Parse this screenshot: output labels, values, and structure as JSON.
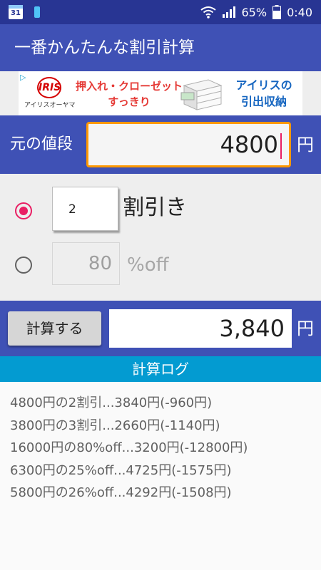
{
  "status_bar": {
    "calendar_day": "31",
    "battery_percent": "65%",
    "time": "0:40",
    "icons": [
      "calendar-icon",
      "battery-small-icon",
      "wifi-icon",
      "signal-icon",
      "battery-icon"
    ]
  },
  "app_bar": {
    "title": "一番かんたんな割引計算"
  },
  "ad": {
    "logo_mark": "IRIS",
    "logo_text": "アイリスオーヤマ",
    "line1": "押入れ・クローゼット",
    "line2": "すっきり",
    "right_line1": "アイリスの",
    "right_line2": "引出収納"
  },
  "price": {
    "label": "元の値段",
    "value": "4800",
    "unit": "円"
  },
  "options": {
    "wari": {
      "value": "2",
      "label": "割引き",
      "selected": true
    },
    "off": {
      "value": "80",
      "label": "%off",
      "selected": false
    }
  },
  "result": {
    "button_label": "計算する",
    "value": "3,840",
    "unit": "円"
  },
  "log": {
    "header": "計算ログ",
    "items": [
      "4800円の2割引...3840円(-960円)",
      "3800円の3割引...2660円(-1140円)",
      "16000円の80%off...3200円(-12800円)",
      "6300円の25%off...4725円(-1575円)",
      "5800円の26%off...4292円(-1508円)"
    ]
  },
  "colors": {
    "primary": "#3f51b5",
    "status_bar": "#283593",
    "accent": "#e91e63",
    "input_focus": "#ff9800",
    "log_header": "#039bd1"
  }
}
